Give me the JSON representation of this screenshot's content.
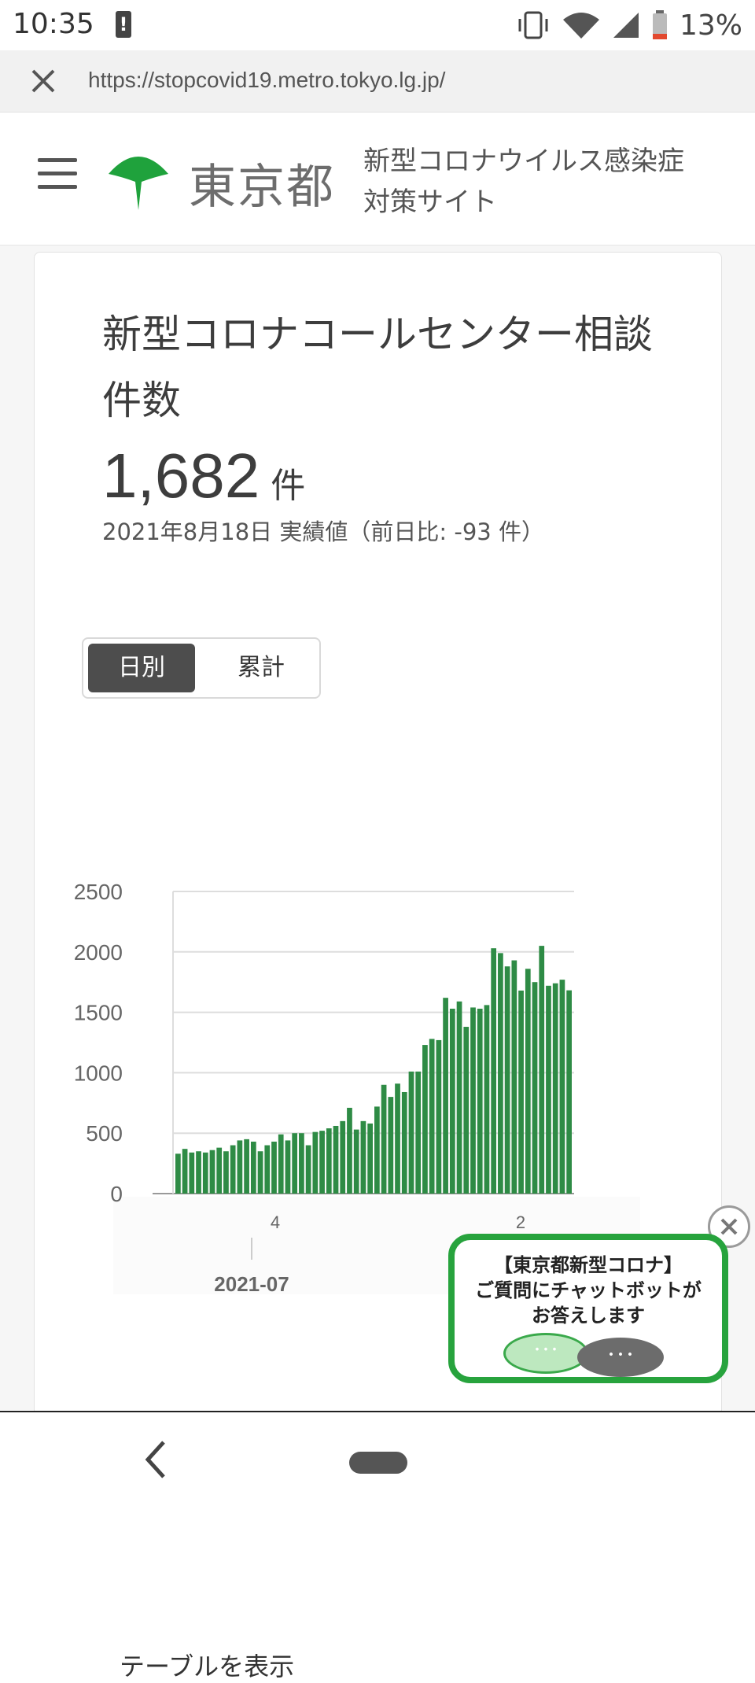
{
  "status_bar": {
    "time": "10:35",
    "battery": "13%",
    "icons": [
      "alert-icon",
      "vibrate-icon",
      "wifi-icon",
      "signal-icon",
      "battery-icon"
    ]
  },
  "url_bar": {
    "url": "https://stopcovid19.metro.tokyo.lg.jp/"
  },
  "header": {
    "city": "東京都",
    "site_line1": "新型コロナウイルス感染症",
    "site_line2": "対策サイト",
    "logo_color": "#1fa23c"
  },
  "card": {
    "title": "新型コロナコールセンター相談件数",
    "value": "1,682",
    "unit": "件",
    "date_note": "2021年8月18日 実績値（前日比: -93 件）"
  },
  "toggle": {
    "daily": "日別",
    "cumulative": "累計",
    "selected": "日別"
  },
  "chart_data": {
    "type": "bar",
    "ylim": [
      0,
      2500
    ],
    "yticks": [
      0,
      500,
      1000,
      1500,
      2000,
      2500
    ],
    "xtick_labels": [
      "4",
      "2"
    ],
    "x_month_label": "2021-07",
    "bar_color": "#2e8b45",
    "grid": true,
    "values": [
      330,
      370,
      340,
      350,
      340,
      360,
      380,
      350,
      400,
      440,
      450,
      430,
      350,
      400,
      430,
      490,
      440,
      500,
      500,
      400,
      510,
      520,
      540,
      560,
      600,
      710,
      530,
      600,
      580,
      720,
      900,
      800,
      910,
      840,
      1010,
      1010,
      1230,
      1280,
      1270,
      1620,
      1530,
      1590,
      1380,
      1540,
      1530,
      1560,
      2030,
      1990,
      1880,
      1930,
      1680,
      1860,
      1750,
      2050,
      1720,
      1740,
      1770,
      1682
    ]
  },
  "chatbot": {
    "line1": "【東京都新型コロナ】",
    "line2": "ご質問にチャットボットが",
    "line3": "お答えします",
    "bubble_green": "･･･",
    "bubble_gray": "･･･"
  },
  "table_toggle": {
    "label": "テーブルを表示"
  }
}
